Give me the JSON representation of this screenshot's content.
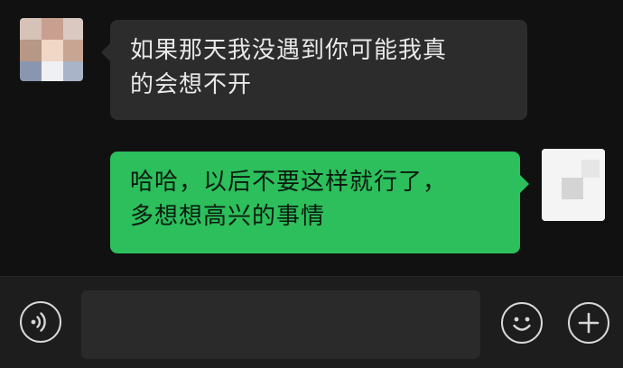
{
  "conversation": {
    "messages": [
      {
        "sender": "contact",
        "lines": [
          "如果那天我没遇到你可能我真",
          "的会想不开"
        ]
      },
      {
        "sender": "self",
        "lines": [
          "哈哈，以后不要这样就行了，",
          "多想想高兴的事情"
        ]
      }
    ]
  },
  "input_bar": {
    "voice_icon": "voice-icon",
    "message_value": "",
    "emoji_icon": "emoji-icon",
    "plus_icon": "plus-icon"
  },
  "colors": {
    "background": "#111111",
    "incoming_bubble": "#2c2c2c",
    "outgoing_bubble": "#2cbf5b",
    "input_bar": "#1d1d1d",
    "input_field": "#2a2a2a"
  }
}
